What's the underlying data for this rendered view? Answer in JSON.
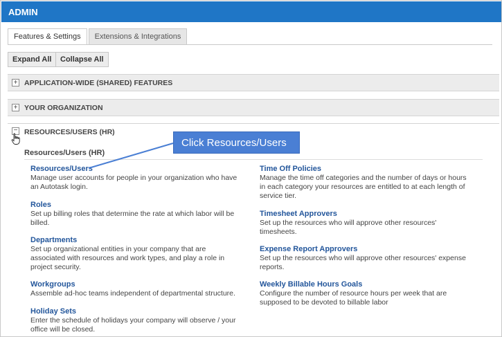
{
  "header": {
    "title": "ADMIN"
  },
  "tabs": [
    {
      "label": "Features & Settings",
      "active": true
    },
    {
      "label": "Extensions & Integrations",
      "active": false
    }
  ],
  "toolbar": {
    "expand_all": "Expand All",
    "collapse_all": "Collapse All"
  },
  "sections": [
    {
      "label": "APPLICATION-WIDE (SHARED) FEATURES",
      "toggle": "+",
      "expanded": false
    },
    {
      "label": "YOUR ORGANIZATION",
      "toggle": "+",
      "expanded": false
    },
    {
      "label": "RESOURCES/USERS (HR)",
      "toggle": "−",
      "expanded": true
    }
  ],
  "resources": {
    "subheading": "Resources/Users (HR)",
    "left": [
      {
        "title": "Resources/Users",
        "desc_lines": [
          "Manage user accounts for people in your organization who have",
          "an Autotask login."
        ]
      },
      {
        "title": "Roles",
        "desc_lines": [
          "Set up billing roles that determine the rate at which labor will be",
          "billed."
        ]
      },
      {
        "title": "Departments",
        "desc_lines": [
          "Set up organizational entities in your company that are",
          "associated with resources and work types, and play a role in",
          "project security."
        ]
      },
      {
        "title": "Workgroups",
        "desc_lines": [
          "Assemble ad-hoc teams independent of departmental structure."
        ]
      },
      {
        "title": "Holiday Sets",
        "desc_lines": [
          "Enter the schedule of holidays your company will observe / your",
          "office will be closed."
        ]
      }
    ],
    "right": [
      {
        "title": "Time Off Policies",
        "desc_lines": [
          "Manage the time off categories and the number of days or hours",
          "in each category your resources are entitled to at each length of",
          "service tier."
        ]
      },
      {
        "title": "Timesheet Approvers",
        "desc_lines": [
          "Set up the resources who will approve other resources'",
          "timesheets."
        ]
      },
      {
        "title": "Expense Report Approvers",
        "desc_lines": [
          "Set up the resources who will approve other resources' expense",
          "reports."
        ]
      },
      {
        "title": "Weekly Billable Hours Goals",
        "desc_lines": [
          "Configure the number of resource hours per week that are",
          "supposed to be devoted to billable labor"
        ]
      }
    ]
  },
  "callout": {
    "text": "Click Resources/Users"
  },
  "colors": {
    "header_bg": "#1f76c6",
    "link": "#23569b",
    "callout_bg": "#4a7fd4"
  }
}
